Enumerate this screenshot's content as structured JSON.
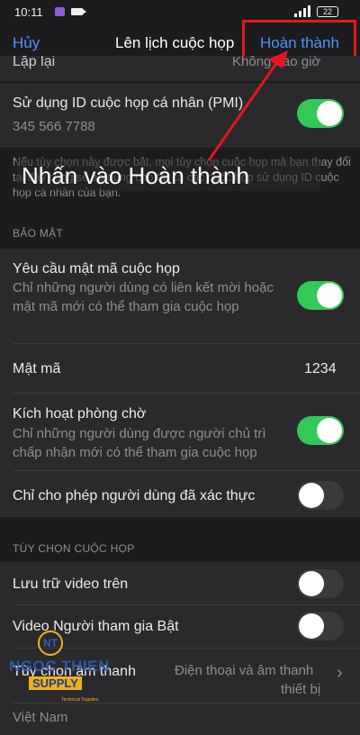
{
  "status": {
    "time": "10:11",
    "battery": "22"
  },
  "nav": {
    "cancel": "Hủy",
    "title": "Lên lịch cuộc họp",
    "done": "Hoàn thành"
  },
  "partial_row": {
    "label": "Lặp lại",
    "value": "Không bao giờ"
  },
  "pmi": {
    "title": "Sử dụng ID cuộc họp cá nhân (PMI)",
    "id": "345 566 7788",
    "enabled": true
  },
  "pmi_note": "Nếu tùy chọn này được bật, mọi tùy chọn cuộc họp mà bạn thay đổi tại đây cũng sẽ áp dụng cho tất cả các cuộc họp sử dụng ID cuộc họp cá nhân của bạn.",
  "annotation": "Nhấn vào Hoàn thành",
  "security": {
    "header": "BẢO MẬT",
    "passcode_required": {
      "title": "Yêu cầu mật mã cuộc họp",
      "description": "Chỉ những người dùng có liên kết mời hoặc mật mã mới có thể tham gia cuộc họp",
      "enabled": true
    },
    "passcode": {
      "label": "Mật mã",
      "value": "1234"
    },
    "waiting_room": {
      "title": "Kích hoạt phòng chờ",
      "description": "Chỉ những người dùng được người chủ trì chấp nhận mới có thể tham gia cuộc họp",
      "enabled": true
    },
    "authenticated_only": {
      "title": "Chỉ cho phép người dùng đã xác thực",
      "enabled": false
    }
  },
  "meeting_options": {
    "header": "TÙY CHỌN CUỘC HỌP",
    "host_video": {
      "title": "Lưu trữ video trên",
      "enabled": false
    },
    "participant_video": {
      "title": "Video Người tham gia Bật",
      "enabled": false
    },
    "audio": {
      "title": "Tùy chọn âm thanh",
      "value_line1": "Điện thoại và âm thanh",
      "value_line2": "thiết bị"
    },
    "country": {
      "label": "Việt Nam"
    }
  },
  "watermark": {
    "initials": "NT",
    "name": "NGOC THIEN",
    "supply": "SUPPLY",
    "tagline": "Technical Supplies"
  },
  "colors": {
    "accent": "#4d93ff",
    "toggle_on": "#34c759",
    "highlight": "#e8141c",
    "background": "#1c1c1e"
  }
}
